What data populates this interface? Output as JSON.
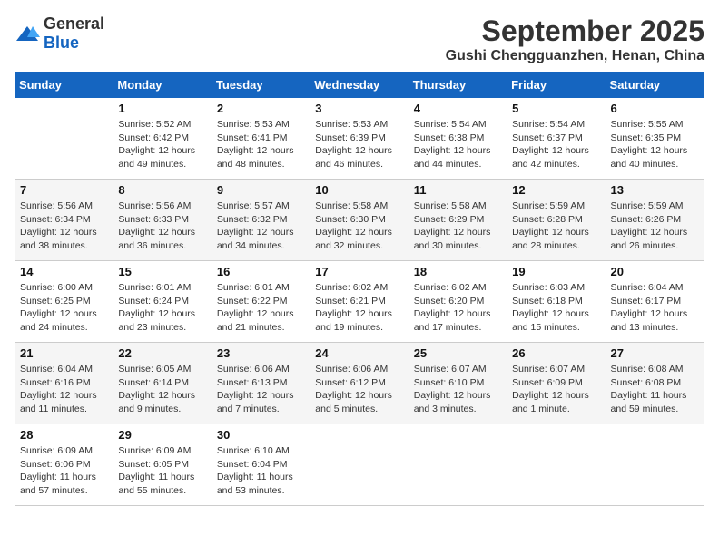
{
  "logo": {
    "general": "General",
    "blue": "Blue"
  },
  "title": "September 2025",
  "subtitle": "Gushi Chengguanzhen, Henan, China",
  "days_header": [
    "Sunday",
    "Monday",
    "Tuesday",
    "Wednesday",
    "Thursday",
    "Friday",
    "Saturday"
  ],
  "weeks": [
    [
      {
        "day": "",
        "info": ""
      },
      {
        "day": "1",
        "info": "Sunrise: 5:52 AM\nSunset: 6:42 PM\nDaylight: 12 hours\nand 49 minutes."
      },
      {
        "day": "2",
        "info": "Sunrise: 5:53 AM\nSunset: 6:41 PM\nDaylight: 12 hours\nand 48 minutes."
      },
      {
        "day": "3",
        "info": "Sunrise: 5:53 AM\nSunset: 6:39 PM\nDaylight: 12 hours\nand 46 minutes."
      },
      {
        "day": "4",
        "info": "Sunrise: 5:54 AM\nSunset: 6:38 PM\nDaylight: 12 hours\nand 44 minutes."
      },
      {
        "day": "5",
        "info": "Sunrise: 5:54 AM\nSunset: 6:37 PM\nDaylight: 12 hours\nand 42 minutes."
      },
      {
        "day": "6",
        "info": "Sunrise: 5:55 AM\nSunset: 6:35 PM\nDaylight: 12 hours\nand 40 minutes."
      }
    ],
    [
      {
        "day": "7",
        "info": "Sunrise: 5:56 AM\nSunset: 6:34 PM\nDaylight: 12 hours\nand 38 minutes."
      },
      {
        "day": "8",
        "info": "Sunrise: 5:56 AM\nSunset: 6:33 PM\nDaylight: 12 hours\nand 36 minutes."
      },
      {
        "day": "9",
        "info": "Sunrise: 5:57 AM\nSunset: 6:32 PM\nDaylight: 12 hours\nand 34 minutes."
      },
      {
        "day": "10",
        "info": "Sunrise: 5:58 AM\nSunset: 6:30 PM\nDaylight: 12 hours\nand 32 minutes."
      },
      {
        "day": "11",
        "info": "Sunrise: 5:58 AM\nSunset: 6:29 PM\nDaylight: 12 hours\nand 30 minutes."
      },
      {
        "day": "12",
        "info": "Sunrise: 5:59 AM\nSunset: 6:28 PM\nDaylight: 12 hours\nand 28 minutes."
      },
      {
        "day": "13",
        "info": "Sunrise: 5:59 AM\nSunset: 6:26 PM\nDaylight: 12 hours\nand 26 minutes."
      }
    ],
    [
      {
        "day": "14",
        "info": "Sunrise: 6:00 AM\nSunset: 6:25 PM\nDaylight: 12 hours\nand 24 minutes."
      },
      {
        "day": "15",
        "info": "Sunrise: 6:01 AM\nSunset: 6:24 PM\nDaylight: 12 hours\nand 23 minutes."
      },
      {
        "day": "16",
        "info": "Sunrise: 6:01 AM\nSunset: 6:22 PM\nDaylight: 12 hours\nand 21 minutes."
      },
      {
        "day": "17",
        "info": "Sunrise: 6:02 AM\nSunset: 6:21 PM\nDaylight: 12 hours\nand 19 minutes."
      },
      {
        "day": "18",
        "info": "Sunrise: 6:02 AM\nSunset: 6:20 PM\nDaylight: 12 hours\nand 17 minutes."
      },
      {
        "day": "19",
        "info": "Sunrise: 6:03 AM\nSunset: 6:18 PM\nDaylight: 12 hours\nand 15 minutes."
      },
      {
        "day": "20",
        "info": "Sunrise: 6:04 AM\nSunset: 6:17 PM\nDaylight: 12 hours\nand 13 minutes."
      }
    ],
    [
      {
        "day": "21",
        "info": "Sunrise: 6:04 AM\nSunset: 6:16 PM\nDaylight: 12 hours\nand 11 minutes."
      },
      {
        "day": "22",
        "info": "Sunrise: 6:05 AM\nSunset: 6:14 PM\nDaylight: 12 hours\nand 9 minutes."
      },
      {
        "day": "23",
        "info": "Sunrise: 6:06 AM\nSunset: 6:13 PM\nDaylight: 12 hours\nand 7 minutes."
      },
      {
        "day": "24",
        "info": "Sunrise: 6:06 AM\nSunset: 6:12 PM\nDaylight: 12 hours\nand 5 minutes."
      },
      {
        "day": "25",
        "info": "Sunrise: 6:07 AM\nSunset: 6:10 PM\nDaylight: 12 hours\nand 3 minutes."
      },
      {
        "day": "26",
        "info": "Sunrise: 6:07 AM\nSunset: 6:09 PM\nDaylight: 12 hours\nand 1 minute."
      },
      {
        "day": "27",
        "info": "Sunrise: 6:08 AM\nSunset: 6:08 PM\nDaylight: 11 hours\nand 59 minutes."
      }
    ],
    [
      {
        "day": "28",
        "info": "Sunrise: 6:09 AM\nSunset: 6:06 PM\nDaylight: 11 hours\nand 57 minutes."
      },
      {
        "day": "29",
        "info": "Sunrise: 6:09 AM\nSunset: 6:05 PM\nDaylight: 11 hours\nand 55 minutes."
      },
      {
        "day": "30",
        "info": "Sunrise: 6:10 AM\nSunset: 6:04 PM\nDaylight: 11 hours\nand 53 minutes."
      },
      {
        "day": "",
        "info": ""
      },
      {
        "day": "",
        "info": ""
      },
      {
        "day": "",
        "info": ""
      },
      {
        "day": "",
        "info": ""
      }
    ]
  ]
}
